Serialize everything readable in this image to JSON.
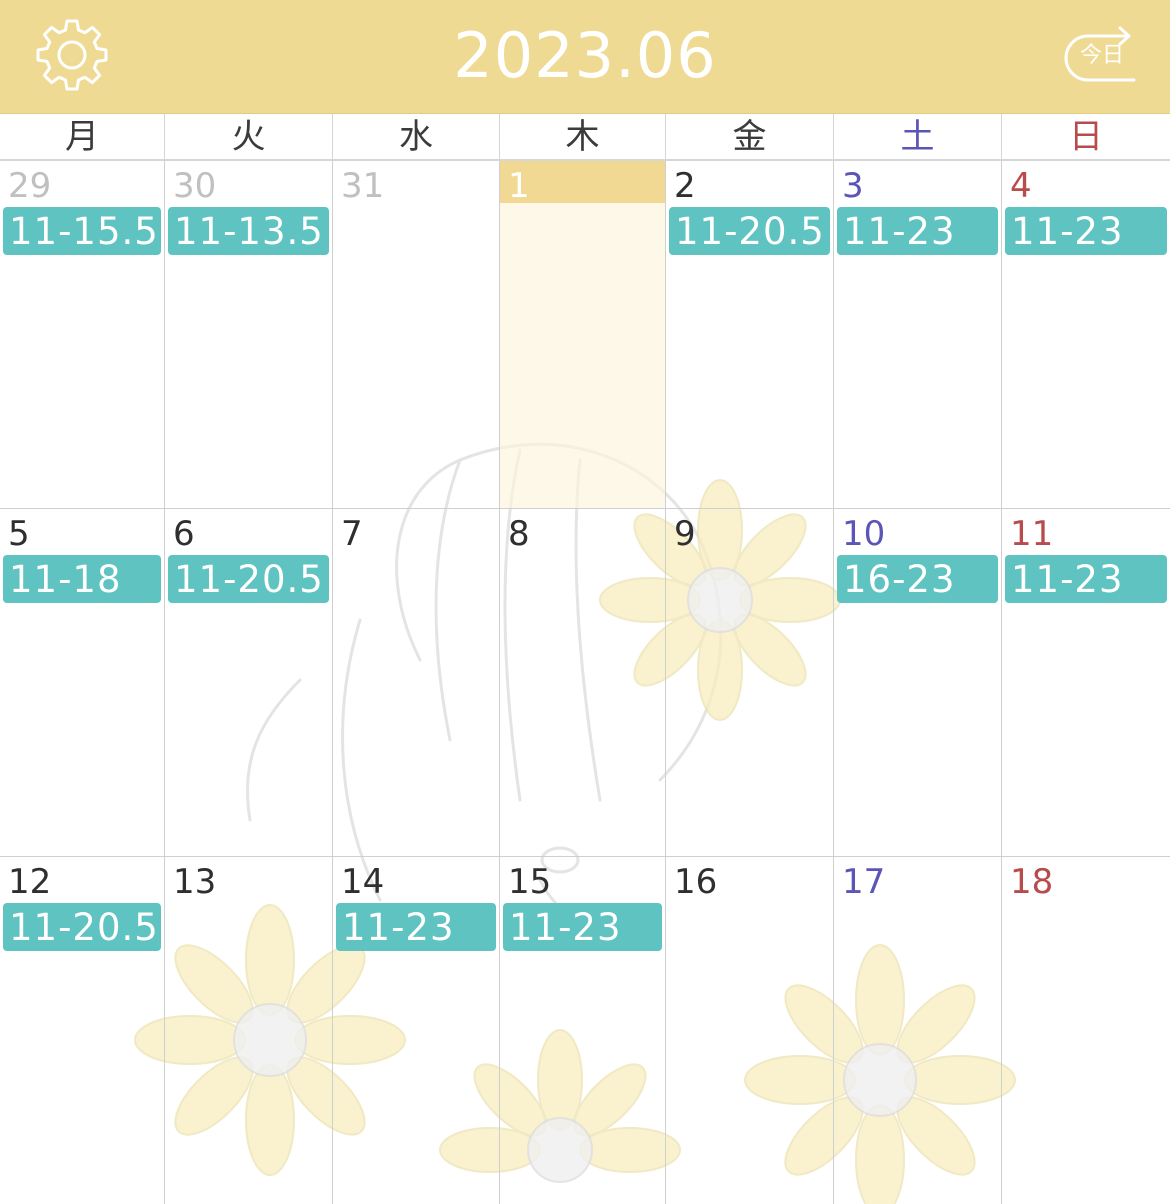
{
  "header": {
    "title": "2023.06",
    "settings_icon": "gear-icon",
    "today_button_label": "今日",
    "today_icon": "return-arrow-icon",
    "background_color": "#efda94"
  },
  "weekdays": [
    "月",
    "火",
    "水",
    "木",
    "金",
    "土",
    "日"
  ],
  "colors": {
    "shift_badge": "#5fc3c2",
    "saturday": "#5a55b6",
    "sunday": "#b84b4b",
    "today_highlight": "#f1d893",
    "other_month_day": "#c0c0c0"
  },
  "weeks": [
    {
      "days": [
        {
          "day": "29",
          "shift": "11-15.5"
        },
        {
          "day": "30",
          "shift": "11-13.5"
        },
        {
          "day": "31",
          "shift": ""
        },
        {
          "day": "1",
          "shift": ""
        },
        {
          "day": "2",
          "shift": "11-20.5"
        },
        {
          "day": "3",
          "shift": "11-23"
        },
        {
          "day": "4",
          "shift": "11-23"
        }
      ]
    },
    {
      "days": [
        {
          "day": "5",
          "shift": "11-18"
        },
        {
          "day": "6",
          "shift": "11-20.5"
        },
        {
          "day": "7",
          "shift": ""
        },
        {
          "day": "8",
          "shift": ""
        },
        {
          "day": "9",
          "shift": ""
        },
        {
          "day": "10",
          "shift": "16-23"
        },
        {
          "day": "11",
          "shift": "11-23"
        }
      ]
    },
    {
      "days": [
        {
          "day": "12",
          "shift": "11-20.5"
        },
        {
          "day": "13",
          "shift": ""
        },
        {
          "day": "14",
          "shift": "11-23"
        },
        {
          "day": "15",
          "shift": "11-23"
        },
        {
          "day": "16",
          "shift": ""
        },
        {
          "day": "17",
          "shift": ""
        },
        {
          "day": "18",
          "shift": ""
        }
      ]
    }
  ],
  "background_art": "sunflower-girl-illustration"
}
